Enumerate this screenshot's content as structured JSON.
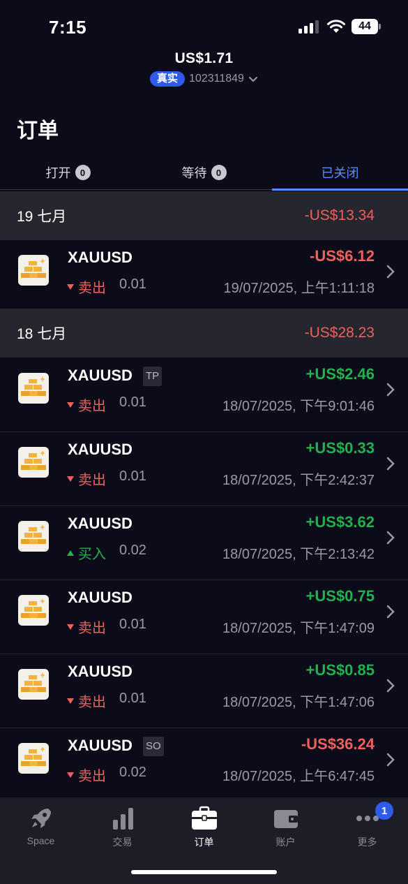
{
  "status_bar": {
    "time": "7:15",
    "battery": "44"
  },
  "account": {
    "balance": "US$1.71",
    "type_badge": "真实",
    "account_number": "102311849"
  },
  "page_title": "订单",
  "tabs": [
    {
      "label": "打开",
      "count": "0"
    },
    {
      "label": "等待",
      "count": "0"
    },
    {
      "label": "已关闭"
    }
  ],
  "groups": [
    {
      "date": "19 七月",
      "total": "-US$13.34",
      "orders": [
        {
          "symbol": "XAUUSD",
          "tag": "",
          "side": "卖出",
          "direction": "sell",
          "volume": "0.01",
          "pnl": "-US$6.12",
          "pnl_sign": "neg",
          "time": "19/07/2025, 上午1:11:18"
        }
      ]
    },
    {
      "date": "18 七月",
      "total": "-US$28.23",
      "orders": [
        {
          "symbol": "XAUUSD",
          "tag": "TP",
          "side": "卖出",
          "direction": "sell",
          "volume": "0.01",
          "pnl": "+US$2.46",
          "pnl_sign": "pos",
          "time": "18/07/2025, 下午9:01:46"
        },
        {
          "symbol": "XAUUSD",
          "tag": "",
          "side": "卖出",
          "direction": "sell",
          "volume": "0.01",
          "pnl": "+US$0.33",
          "pnl_sign": "pos",
          "time": "18/07/2025, 下午2:42:37"
        },
        {
          "symbol": "XAUUSD",
          "tag": "",
          "side": "买入",
          "direction": "buy",
          "volume": "0.02",
          "pnl": "+US$3.62",
          "pnl_sign": "pos",
          "time": "18/07/2025, 下午2:13:42"
        },
        {
          "symbol": "XAUUSD",
          "tag": "",
          "side": "卖出",
          "direction": "sell",
          "volume": "0.01",
          "pnl": "+US$0.75",
          "pnl_sign": "pos",
          "time": "18/07/2025, 下午1:47:09"
        },
        {
          "symbol": "XAUUSD",
          "tag": "",
          "side": "卖出",
          "direction": "sell",
          "volume": "0.01",
          "pnl": "+US$0.85",
          "pnl_sign": "pos",
          "time": "18/07/2025, 下午1:47:06"
        },
        {
          "symbol": "XAUUSD",
          "tag": "SO",
          "side": "卖出",
          "direction": "sell",
          "volume": "0.02",
          "pnl": "-US$36.24",
          "pnl_sign": "neg",
          "time": "18/07/2025, 上午6:47:45"
        }
      ]
    }
  ],
  "bottom_nav": [
    {
      "label": "Space",
      "icon": "rocket-icon"
    },
    {
      "label": "交易",
      "icon": "bar-chart-icon"
    },
    {
      "label": "订单",
      "icon": "briefcase-icon",
      "active": true
    },
    {
      "label": "账户",
      "icon": "wallet-icon"
    },
    {
      "label": "更多",
      "icon": "more-icon",
      "badge": "1"
    }
  ],
  "colors": {
    "accent": "#5b8cff",
    "profit": "#22b14c",
    "loss": "#f0605d",
    "badge": "#2f5bea"
  }
}
